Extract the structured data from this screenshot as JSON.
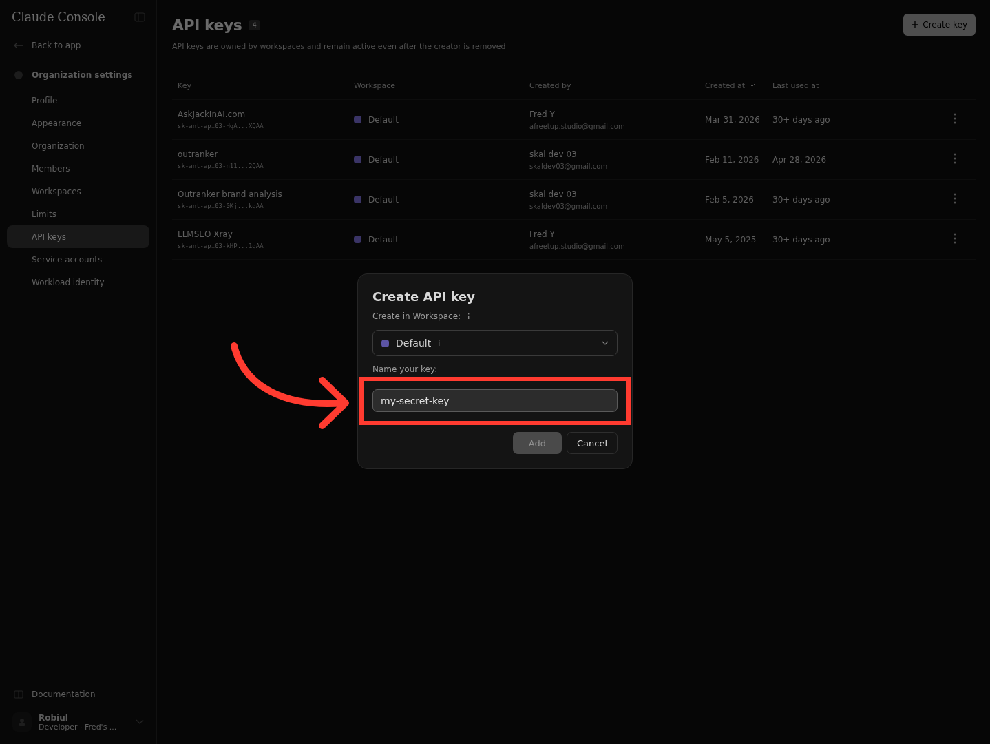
{
  "sidebar": {
    "logo": "Claude Console",
    "back_link": "Back to app",
    "section": "Organization settings",
    "items": [
      {
        "label": "Profile",
        "selected": false
      },
      {
        "label": "Appearance",
        "selected": false
      },
      {
        "label": "Organization",
        "selected": false
      },
      {
        "label": "Members",
        "selected": false
      },
      {
        "label": "Workspaces",
        "selected": false
      },
      {
        "label": "Limits",
        "selected": false
      },
      {
        "label": "API keys",
        "selected": true
      },
      {
        "label": "Service accounts",
        "selected": false
      },
      {
        "label": "Workload identity",
        "selected": false
      }
    ],
    "documentation": "Documentation",
    "user": {
      "name": "Robiul",
      "subtitle": "Developer · Fred's ..."
    }
  },
  "page": {
    "title": "API keys",
    "count": "4",
    "description": "API keys are owned by workspaces and remain active even after the creator is removed",
    "create_button": "Create key"
  },
  "table": {
    "columns": [
      "Key",
      "Workspace",
      "Created by",
      "Created at",
      "Last used at"
    ],
    "rows": [
      {
        "name": "AskJackInAI.com",
        "key": "sk-ant-api03-HqA...XQAA",
        "workspace": "Default",
        "created_by": "Fred Y",
        "email": "afreetup.studio@gmail.com",
        "created_at": "Mar 31, 2026",
        "last_used": "30+ days ago"
      },
      {
        "name": "outranker",
        "key": "sk-ant-api03-n11...2QAA",
        "workspace": "Default",
        "created_by": "skal dev 03",
        "email": "skaldev03@gmail.com",
        "created_at": "Feb 11, 2026",
        "last_used": "Apr 28, 2026"
      },
      {
        "name": "Outranker brand analysis",
        "key": "sk-ant-api03-0Kj...kgAA",
        "workspace": "Default",
        "created_by": "skal dev 03",
        "email": "skaldev03@gmail.com",
        "created_at": "Feb 5, 2026",
        "last_used": "30+ days ago"
      },
      {
        "name": "LLMSEO Xray",
        "key": "sk-ant-api03-kHP...1gAA",
        "workspace": "Default",
        "created_by": "Fred Y",
        "email": "afreetup.studio@gmail.com",
        "created_at": "May 5, 2025",
        "last_used": "30+ days ago"
      }
    ]
  },
  "dialog": {
    "title": "Create API key",
    "workspace_label": "Create in Workspace:",
    "workspace": "Default",
    "name_label": "Name your key:",
    "name_value": "my-secret-key",
    "buttons": [
      {
        "label": "Add",
        "kind": "primary",
        "disabled": true
      },
      {
        "label": "Cancel",
        "kind": "secondary",
        "disabled": false
      }
    ]
  }
}
